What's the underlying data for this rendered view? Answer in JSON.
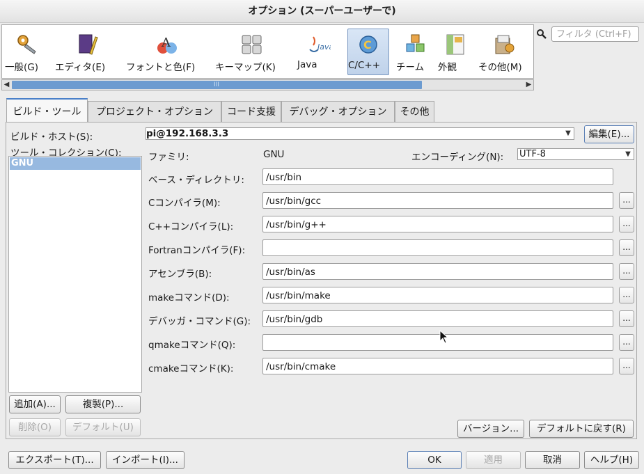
{
  "window": {
    "title": "オプション (スーパーユーザーで)"
  },
  "categories": [
    {
      "label": "一般(G)",
      "icon": "gear-wrench-icon"
    },
    {
      "label": "エディタ(E)",
      "icon": "editor-book-icon"
    },
    {
      "label": "フォントと色(F)",
      "icon": "fonts-colors-icon"
    },
    {
      "label": "キーマップ(K)",
      "icon": "keyboard-icon"
    },
    {
      "label": "Java",
      "icon": "java-icon"
    },
    {
      "label": "C/C++",
      "icon": "cpp-icon",
      "selected": true
    },
    {
      "label": "チーム",
      "icon": "team-blocks-icon"
    },
    {
      "label": "外観",
      "icon": "appearance-icon"
    },
    {
      "label": "その他(M)",
      "icon": "misc-icon"
    }
  ],
  "search": {
    "placeholder": "フィルタ (Ctrl+F)"
  },
  "tabs": [
    "ビルド・ツール",
    "プロジェクト・オプション",
    "コード支援",
    "デバッグ・オプション",
    "その他"
  ],
  "build_tools": {
    "build_host_label": "ビルド・ホスト(S):",
    "build_host_value": "pi@192.168.3.3",
    "edit_button": "編集(E)...",
    "tool_collection_label": "ツール・コレクション(C):",
    "collections": [
      "GNU"
    ],
    "family_label": "ファミリ:",
    "family_value": "GNU",
    "encoding_label": "エンコーディング(N):",
    "encoding_value": "UTF-8",
    "base_dir_label": "ベース・ディレクトリ:",
    "base_dir_value": "/usr/bin",
    "tools": [
      {
        "label": "Cコンパイラ(M):",
        "value": "/usr/bin/gcc"
      },
      {
        "label": "C++コンパイラ(L):",
        "value": "/usr/bin/g++"
      },
      {
        "label": "Fortranコンパイラ(F):",
        "value": ""
      },
      {
        "label": "アセンブラ(B):",
        "value": "/usr/bin/as"
      },
      {
        "label": "makeコマンド(D):",
        "value": "/usr/bin/make"
      },
      {
        "label": "デバッガ・コマンド(G):",
        "value": "/usr/bin/gdb"
      },
      {
        "label": "qmakeコマンド(Q):",
        "value": ""
      },
      {
        "label": "cmakeコマンド(K):",
        "value": "/usr/bin/cmake"
      }
    ],
    "browse_label": "...",
    "add_button": "追加(A)...",
    "duplicate_button": "複製(P)...",
    "remove_button": "削除(O)",
    "default_button": "デフォルト(U)",
    "versions_button": "バージョン...",
    "restore_defaults_button": "デフォルトに戻す(R)"
  },
  "footer": {
    "export_button": "エクスポート(T)...",
    "import_button": "インポート(I)...",
    "ok_button": "OK",
    "apply_button": "適用",
    "cancel_button": "取消",
    "help_button": "ヘルプ(H)"
  },
  "colors": {
    "selection": "#97b9e0",
    "scroll_thumb": "#6c9bd0",
    "tab_accent": "#4a80c9"
  }
}
